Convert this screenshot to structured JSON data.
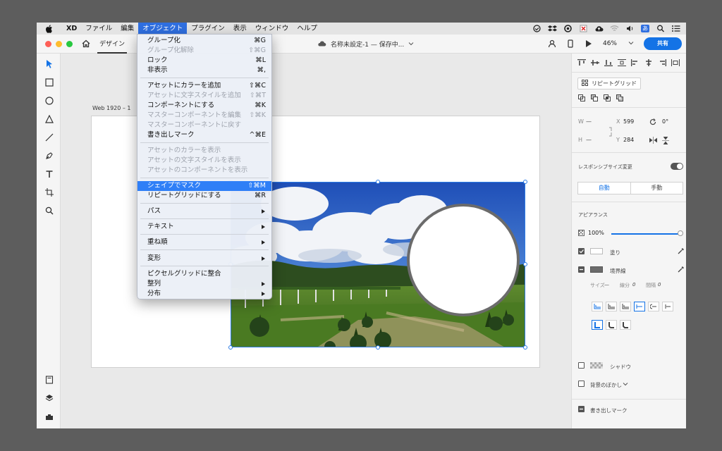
{
  "menubar": {
    "app": "XD",
    "items": [
      "ファイル",
      "編集",
      "オブジェクト",
      "プラグイン",
      "表示",
      "ウィンドウ",
      "ヘルプ"
    ],
    "active_index": 2,
    "input_lang": "あ"
  },
  "titlebar": {
    "tab": "デザイン",
    "doc_title": "名称未設定-1 — 保存中...",
    "zoom": "46%",
    "share": "共有"
  },
  "canvas": {
    "artboard_name": "Web 1920 – 1"
  },
  "menu": {
    "items": [
      {
        "label": "グループ化",
        "shortcut": "⌘G",
        "disabled": false
      },
      {
        "label": "グループ化解除",
        "shortcut": "⇧⌘G",
        "disabled": true
      },
      {
        "label": "ロック",
        "shortcut": "⌘L",
        "disabled": false
      },
      {
        "label": "非表示",
        "shortcut": "⌘,",
        "disabled": false
      },
      {
        "label": "アセットにカラーを追加",
        "shortcut": "⇧⌘C",
        "disabled": false
      },
      {
        "label": "アセットに文字スタイルを追加",
        "shortcut": "⇧⌘T",
        "disabled": true
      },
      {
        "label": "コンポーネントにする",
        "shortcut": "⌘K",
        "disabled": false
      },
      {
        "label": "マスターコンポーネントを編集",
        "shortcut": "⇧⌘K",
        "disabled": true
      },
      {
        "label": "マスターコンポーネントに戻す",
        "shortcut": "",
        "disabled": true
      },
      {
        "label": "書き出しマーク",
        "shortcut": "^⌘E",
        "disabled": false
      },
      {
        "label": "アセットのカラーを表示",
        "shortcut": "",
        "disabled": true
      },
      {
        "label": "アセットの文字スタイルを表示",
        "shortcut": "",
        "disabled": true
      },
      {
        "label": "アセットのコンポーネントを表示",
        "shortcut": "",
        "disabled": true
      },
      {
        "label": "シェイプでマスク",
        "shortcut": "⇧⌘M",
        "disabled": false,
        "highlighted": true
      },
      {
        "label": "リピートグリッドにする",
        "shortcut": "⌘R",
        "disabled": false
      },
      {
        "label": "パス",
        "submenu": true
      },
      {
        "label": "テキスト",
        "submenu": true
      },
      {
        "label": "重ね順",
        "submenu": true
      },
      {
        "label": "変形",
        "submenu": true
      },
      {
        "label": "ピクセルグリッドに整合",
        "shortcut": "",
        "disabled": false
      },
      {
        "label": "整列",
        "submenu": true
      },
      {
        "label": "分布",
        "submenu": true
      }
    ]
  },
  "panel": {
    "repeat_grid": "リピートグリッド",
    "w_label": "W",
    "w_value": "—",
    "h_label": "H",
    "h_value": "—",
    "x_label": "X",
    "x_value": "599",
    "y_label": "Y",
    "y_value": "284",
    "rotation": "0°",
    "responsive_resize": "レスポンシブサイズ変更",
    "auto": "自動",
    "manual": "手動",
    "appearance": "アピアランス",
    "opacity": "100%",
    "fill": "塗り",
    "border": "境界線",
    "size_label": "サイズ",
    "size_value": "—",
    "dash_label": "線分",
    "dash_value": "0",
    "gap_label": "間隔",
    "gap_value": "0",
    "shadow": "シャドウ",
    "bg_blur": "背景のぼかし",
    "export_mark": "書き出しマーク",
    "accent_color": "#1473e6"
  }
}
